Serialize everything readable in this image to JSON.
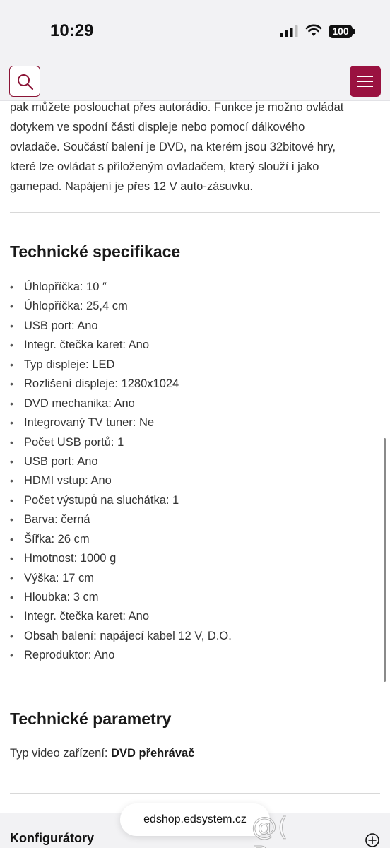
{
  "status_bar": {
    "time": "10:29",
    "battery": "100"
  },
  "description_lines": [
    "pak můžete poslouchat přes autorádio. Funkce je možno ovládat",
    "dotykem ve spodní části displeje nebo pomocí dálkového",
    "ovladače. Součástí balení je DVD, na kterém jsou 32bitové hry,",
    "které lze ovládat s přiloženým ovladačem, který slouží i jako",
    "gamepad. Napájení je přes 12 V auto-zásuvku."
  ],
  "tech_specs": {
    "title": "Technické specifikace",
    "items": [
      "Úhlopříčka: 10 ″",
      "Úhlopříčka: 25,4 cm",
      "USB port: Ano",
      "Integr. čtečka karet: Ano",
      "Typ displeje: LED",
      "Rozlišení displeje: 1280x1024",
      "DVD mechanika: Ano",
      "Integrovaný TV tuner: Ne",
      "Počet USB portů: 1",
      "USB port: Ano",
      "HDMI vstup: Ano",
      "Počet výstupů na sluchátka: 1",
      "Barva: černá",
      "Šířka: 26 cm",
      "Hmotnost: 1000 g",
      "Výška: 17 cm",
      "Hloubka: 3 cm",
      "Integr. čtečka karet: Ano",
      "Obsah balení: napájecí kabel 12 V, D.O.",
      "Reproduktor: Ano"
    ]
  },
  "tech_params": {
    "title": "Technické parametry",
    "label": "Typ video zařízení: ",
    "value": "DVD přehrávač"
  },
  "footer": {
    "title": "Konfigurátory"
  },
  "browser": {
    "url": "edshop.edsystem.cz"
  },
  "watermark": "@( Bazos.cz",
  "colors": {
    "brand": "#9a1240",
    "background": "#ffffff",
    "chrome": "#f2f2f4"
  },
  "icons": {
    "search": "search-icon",
    "menu": "hamburger-menu-icon",
    "expand": "plus-circle-icon"
  }
}
